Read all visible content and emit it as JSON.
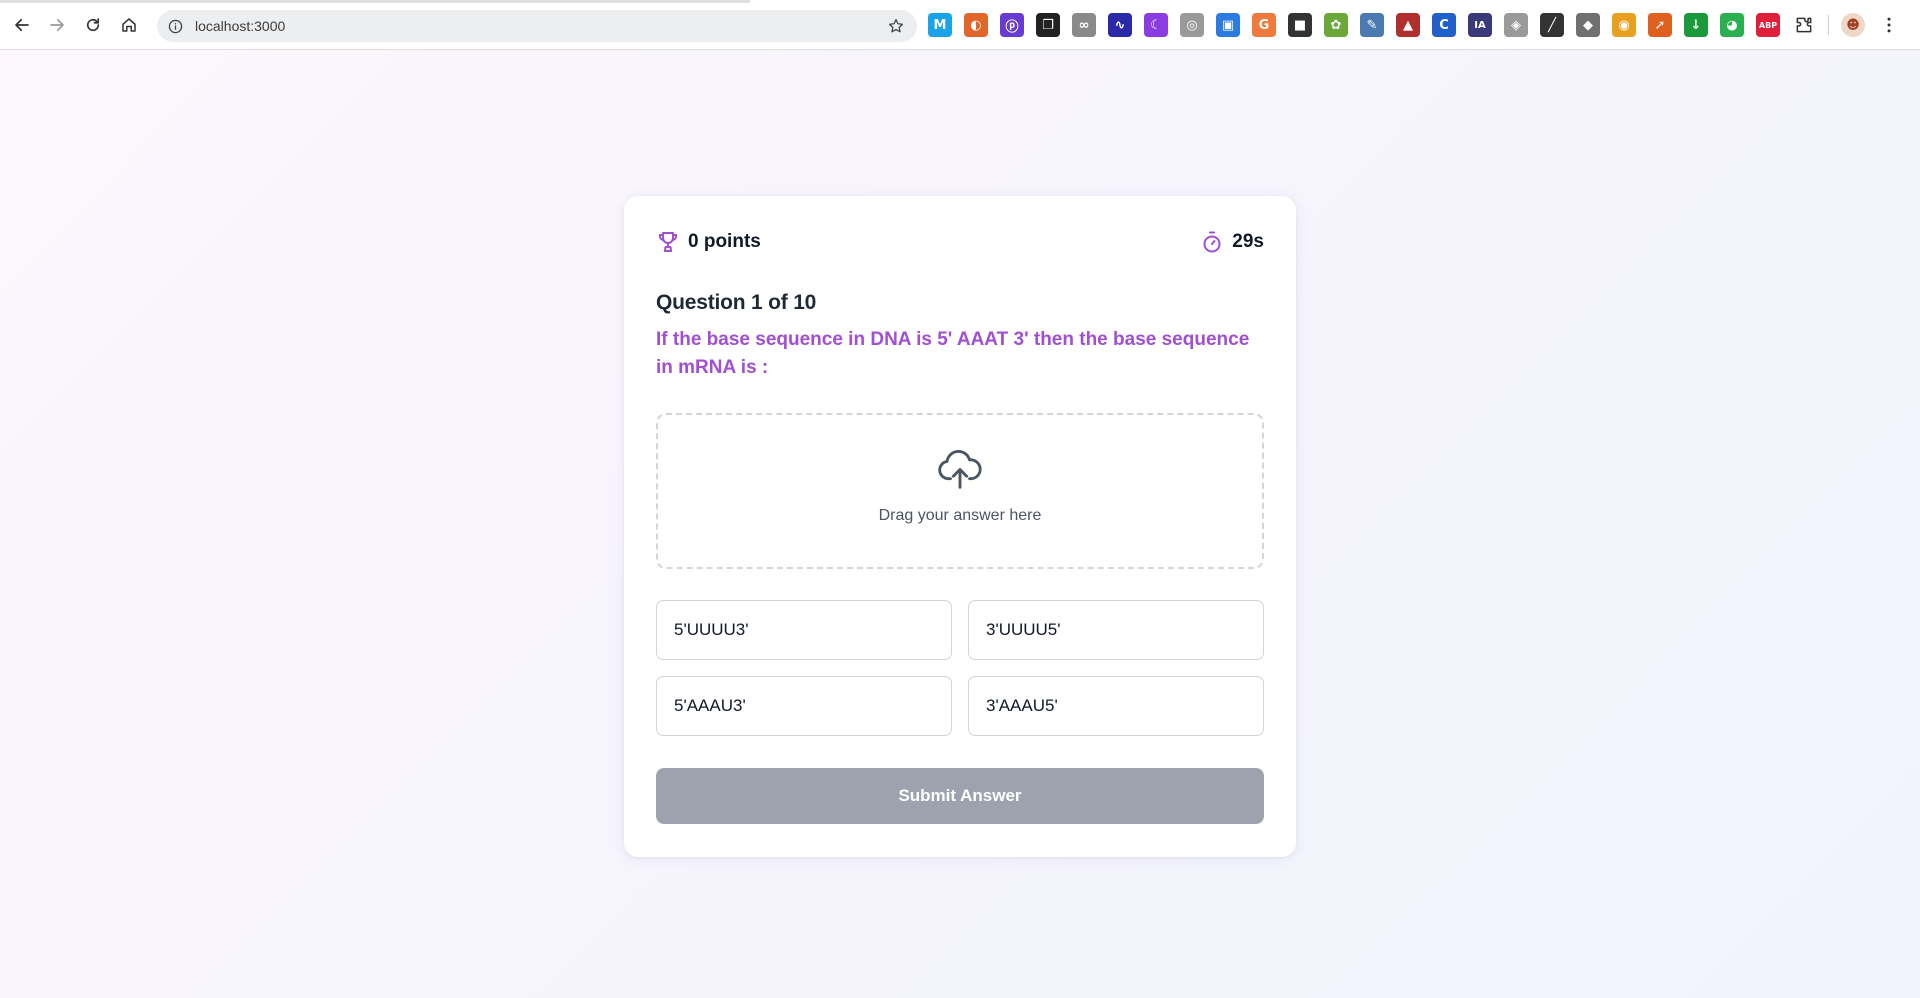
{
  "browser": {
    "url": "localhost:3000",
    "extensions": [
      {
        "name": "m-extension",
        "glyph": "M",
        "color": "#1aa3e8"
      },
      {
        "name": "swirl-extension",
        "glyph": "◐",
        "color": "#e0662a"
      },
      {
        "name": "p-extension",
        "glyph": "ⓟ",
        "color": "#6a3bd1"
      },
      {
        "name": "copy-extension",
        "glyph": "❐",
        "color": "#222222"
      },
      {
        "name": "link-extension",
        "glyph": "∞",
        "color": "#8a8a8a"
      },
      {
        "name": "chart-extension",
        "glyph": "∿",
        "color": "#2a2aa8"
      },
      {
        "name": "moon-extension",
        "glyph": "☾",
        "color": "#8a3ce0"
      },
      {
        "name": "camera-extension",
        "glyph": "◎",
        "color": "#9a9a9a"
      },
      {
        "name": "screen-extension",
        "glyph": "▣",
        "color": "#2b7be0"
      },
      {
        "name": "g-extension",
        "glyph": "G",
        "color": "#f07a3c"
      },
      {
        "name": "train-extension",
        "glyph": "■",
        "color": "#333333"
      },
      {
        "name": "leaf-extension",
        "glyph": "✿",
        "color": "#6aa83a"
      },
      {
        "name": "tool-extension",
        "glyph": "✎",
        "color": "#4a7ab0"
      },
      {
        "name": "hat-extension",
        "glyph": "▲",
        "color": "#b03030"
      },
      {
        "name": "c-extension",
        "glyph": "C",
        "color": "#2060c8"
      },
      {
        "name": "ia-extension",
        "glyph": "IA",
        "color": "#3a3a7a"
      },
      {
        "name": "target-extension",
        "glyph": "◈",
        "color": "#9a9a9a"
      },
      {
        "name": "pen-extension",
        "glyph": "╱",
        "color": "#333333"
      },
      {
        "name": "shield-extension",
        "glyph": "◆",
        "color": "#707070"
      },
      {
        "name": "chrome-extension",
        "glyph": "◉",
        "color": "#e8a020"
      },
      {
        "name": "arrow-extension",
        "glyph": "➚",
        "color": "#e06020"
      },
      {
        "name": "download-extension",
        "glyph": "↓",
        "color": "#1a9a3a"
      },
      {
        "name": "eye-extension",
        "glyph": "◕",
        "color": "#2ab050"
      },
      {
        "name": "abp-extension",
        "glyph": "ABP",
        "color": "#e0203a"
      }
    ]
  },
  "quiz": {
    "score": "0 points",
    "timer": "29s",
    "question_counter": "Question 1 of 10",
    "question_text": "If the base sequence in DNA is 5' AAAT 3' then the base sequence in mRNA is :",
    "dropzone_label": "Drag your answer here",
    "options": [
      "5'UUUU3'",
      "3'UUUU5'",
      "5'AAAU3'",
      "3'AAAU5'"
    ],
    "submit_label": "Submit Answer"
  },
  "colors": {
    "accent": "#a14fd3",
    "submit_disabled": "#9ca3af"
  }
}
